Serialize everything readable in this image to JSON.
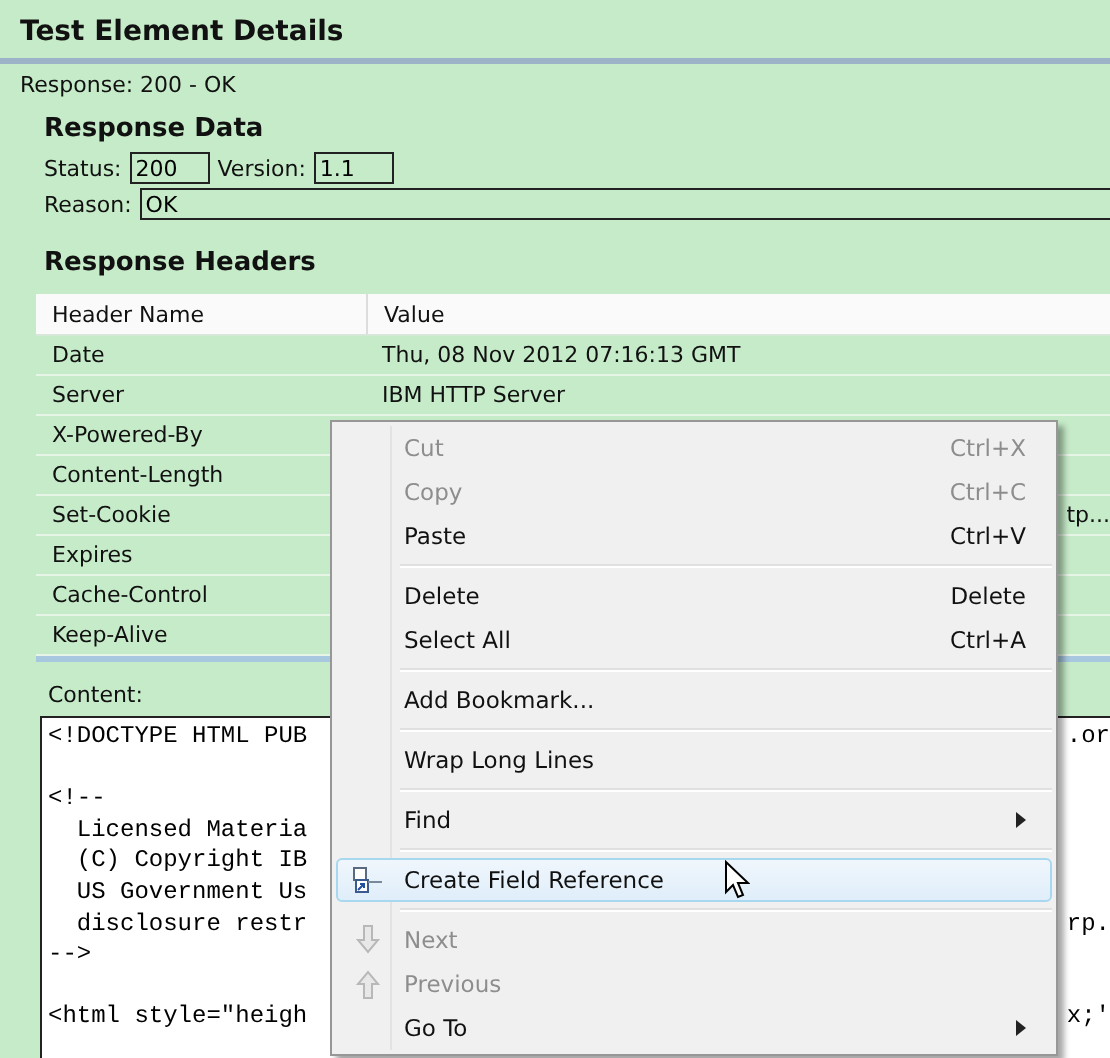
{
  "title": "Test Element Details",
  "response_line": "Response: 200 - OK",
  "response_data": {
    "heading": "Response Data",
    "status_label": "Status:",
    "status": "200",
    "version_label": "Version:",
    "version": "1.1",
    "reason_label": "Reason:",
    "reason": "OK"
  },
  "response_headers": {
    "heading": "Response Headers",
    "columns": [
      "Header Name",
      "Value"
    ],
    "rows": [
      {
        "name": "Date",
        "value": "Thu, 08 Nov 2012 07:16:13 GMT"
      },
      {
        "name": "Server",
        "value": "IBM HTTP Server"
      },
      {
        "name": "X-Powered-By"
      },
      {
        "name": "Content-Length"
      },
      {
        "name": "Set-Cookie",
        "value_end": "tp..."
      },
      {
        "name": "Expires"
      },
      {
        "name": "Cache-Control"
      },
      {
        "name": "Keep-Alive"
      }
    ]
  },
  "content": {
    "label": "Content:",
    "lines": [
      {
        "kind": "code",
        "text": "<!DOCTYPE HTML PUB",
        "end": ".or"
      },
      {
        "kind": "blank"
      },
      {
        "kind": "code",
        "text": "<!--"
      },
      {
        "kind": "code",
        "text": "  Licensed Materia"
      },
      {
        "kind": "code",
        "text": "  (C) Copyright IB"
      },
      {
        "kind": "code",
        "text": "  US Government Us"
      },
      {
        "kind": "code",
        "text": "  disclosure restr",
        "end": "rp."
      },
      {
        "kind": "code",
        "text": "-->"
      },
      {
        "kind": "blank"
      },
      {
        "kind": "code",
        "text": "<html style=\"heigh",
        "end": "x;'"
      }
    ]
  },
  "context_menu": [
    {
      "kind": "command",
      "label": "Cut",
      "shortcut": "Ctrl+X",
      "disabled": true,
      "selected": false
    },
    {
      "kind": "command",
      "label": "Copy",
      "shortcut": "Ctrl+C",
      "disabled": true,
      "selected": false
    },
    {
      "kind": "command",
      "label": "Paste",
      "shortcut": "Ctrl+V",
      "disabled": false,
      "selected": false
    },
    {
      "kind": "separator"
    },
    {
      "kind": "command",
      "label": "Delete",
      "shortcut": "Delete",
      "disabled": false,
      "selected": false
    },
    {
      "kind": "command",
      "label": "Select All",
      "shortcut": "Ctrl+A",
      "disabled": false,
      "selected": false
    },
    {
      "kind": "separator"
    },
    {
      "kind": "command",
      "label": "Add Bookmark...",
      "disabled": false,
      "selected": false
    },
    {
      "kind": "separator"
    },
    {
      "kind": "command",
      "label": "Wrap Long Lines",
      "disabled": false,
      "selected": false
    },
    {
      "kind": "separator"
    },
    {
      "kind": "submenu",
      "label": "Find",
      "disabled": false,
      "selected": false
    },
    {
      "kind": "separator"
    },
    {
      "kind": "icon-command",
      "label": "Create Field Reference",
      "disabled": false,
      "selected": true
    },
    {
      "kind": "separator"
    },
    {
      "kind": "icon-command",
      "label": "Next",
      "disabled": true,
      "selected": false
    },
    {
      "kind": "icon-command",
      "label": "Previous",
      "disabled": true,
      "selected": false
    },
    {
      "kind": "submenu",
      "label": "Go To",
      "disabled": false,
      "selected": false
    }
  ]
}
